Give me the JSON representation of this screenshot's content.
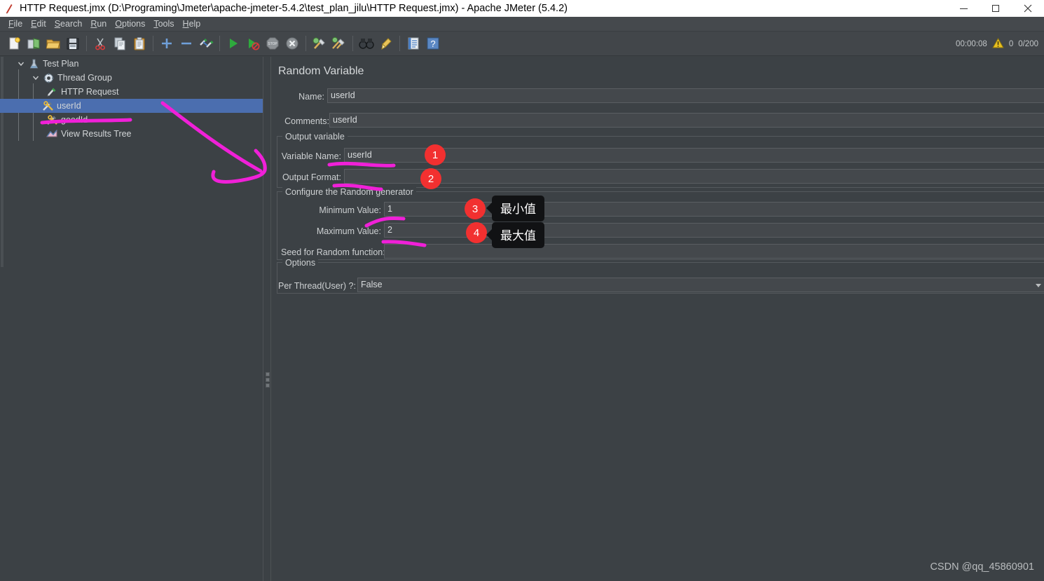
{
  "window": {
    "title": "HTTP Request.jmx (D:\\Programing\\Jmeter\\apache-jmeter-5.4.2\\test_plan_jilu\\HTTP Request.jmx) - Apache JMeter (5.4.2)",
    "app_icon": "jmeter-feather-icon",
    "minimize_label": "—",
    "maximize_label": "▢",
    "close_label": "✕"
  },
  "menubar": {
    "items": [
      {
        "mnemonic": "F",
        "rest": "ile"
      },
      {
        "mnemonic": "E",
        "rest": "dit"
      },
      {
        "mnemonic": "S",
        "rest": "earch"
      },
      {
        "mnemonic": "R",
        "rest": "un"
      },
      {
        "mnemonic": "O",
        "rest": "ptions"
      },
      {
        "mnemonic": "T",
        "rest": "ools"
      },
      {
        "mnemonic": "H",
        "rest": "elp"
      }
    ]
  },
  "toolbar": {
    "buttons": [
      {
        "name": "new-button",
        "icon": "new-document-icon"
      },
      {
        "name": "templates-button",
        "icon": "templates-icon"
      },
      {
        "name": "open-button",
        "icon": "open-folder-icon"
      },
      {
        "name": "save-button",
        "icon": "save-disk-icon"
      },
      {
        "sep": true
      },
      {
        "name": "cut-button",
        "icon": "scissors-icon"
      },
      {
        "name": "copy-button",
        "icon": "copy-icon"
      },
      {
        "name": "paste-button",
        "icon": "clipboard-icon"
      },
      {
        "sep": true
      },
      {
        "name": "expand-all-button",
        "icon": "plus-icon"
      },
      {
        "name": "collapse-all-button",
        "icon": "minus-icon"
      },
      {
        "name": "toggle-button",
        "icon": "toggle-pencil-icon"
      },
      {
        "sep": true
      },
      {
        "name": "start-button",
        "icon": "play-green-icon"
      },
      {
        "name": "start-no-pauses-button",
        "icon": "play-no-pause-icon"
      },
      {
        "name": "stop-button",
        "icon": "stop-sign-icon"
      },
      {
        "name": "shutdown-button",
        "icon": "shutdown-x-icon"
      },
      {
        "sep": true
      },
      {
        "name": "clear-button",
        "icon": "broom-gear-icon"
      },
      {
        "name": "clear-all-button",
        "icon": "broom-gear-all-icon"
      },
      {
        "sep": true
      },
      {
        "name": "search-button",
        "icon": "binoculars-icon"
      },
      {
        "name": "reset-search-button",
        "icon": "broom-icon"
      },
      {
        "sep": true
      },
      {
        "name": "function-helper-button",
        "icon": "function-list-icon"
      },
      {
        "name": "help-button",
        "icon": "help-question-icon"
      }
    ],
    "status": {
      "elapsed_time": "00:00:08",
      "warning_icon": "warning-triangle-icon",
      "error_count": "0",
      "thread_counter": "0/200"
    }
  },
  "tree": {
    "nodes": [
      {
        "label": "Test Plan",
        "icon": "test-plan-icon",
        "depth": 0,
        "toggle": "chevron-down",
        "selected": false
      },
      {
        "label": "Thread Group",
        "icon": "thread-group-icon",
        "depth": 1,
        "toggle": "chevron-down",
        "selected": false
      },
      {
        "label": "HTTP Request",
        "icon": "http-request-icon",
        "depth": 2,
        "toggle": "",
        "selected": false
      },
      {
        "label": "userId",
        "icon": "random-variable-icon",
        "depth": 2,
        "toggle": "",
        "selected": true
      },
      {
        "label": "goodId",
        "icon": "random-variable-icon",
        "depth": 2,
        "toggle": "",
        "selected": false
      },
      {
        "label": "View Results Tree",
        "icon": "view-results-icon",
        "depth": 2,
        "toggle": "",
        "selected": false
      }
    ]
  },
  "main": {
    "panel_title": "Random Variable",
    "name": {
      "label": "Name:",
      "value": "userId"
    },
    "comments": {
      "label": "Comments:",
      "value": "userId"
    },
    "output_variable_group": {
      "legend": "Output variable",
      "variable_name": {
        "label": "Variable Name:",
        "value": "userId"
      },
      "output_format": {
        "label": "Output Format:",
        "value": ""
      }
    },
    "random_generator_group": {
      "legend": "Configure the Random generator",
      "minimum_value": {
        "label": "Minimum Value:",
        "value": "1"
      },
      "maximum_value": {
        "label": "Maximum Value:",
        "value": "2"
      },
      "seed": {
        "label": "Seed for Random function:",
        "value": ""
      }
    },
    "options_group": {
      "legend": "Options",
      "per_thread": {
        "label": "Per Thread(User) ?:",
        "value": "False"
      }
    }
  },
  "annotations": {
    "badges": [
      "1",
      "2",
      "3",
      "4"
    ],
    "tooltips": {
      "minimum": "最小值",
      "maximum": "最大值"
    },
    "ink_color": "#f020d8"
  },
  "watermark": "CSDN @qq_45860901"
}
